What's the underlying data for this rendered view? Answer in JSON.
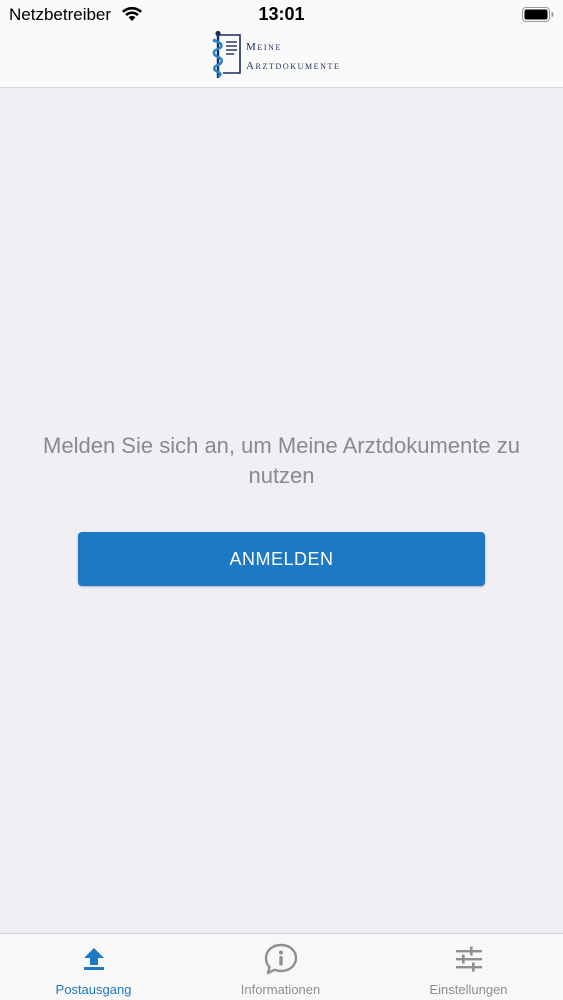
{
  "status_bar": {
    "carrier": "Netzbetreiber",
    "time": "13:01"
  },
  "header": {
    "logo_line1": "Meine",
    "logo_line2": "Arztdokumente",
    "logo_color": "#1a2a5a"
  },
  "main": {
    "message": "Melden Sie sich an, um Meine Arztdokumente zu nutzen",
    "login_button_label": "ANMELDEN",
    "accent_color": "#1d79c3"
  },
  "tab_bar": {
    "tabs": [
      {
        "label": "Postausgang",
        "icon": "upload-icon",
        "active": true
      },
      {
        "label": "Informationen",
        "icon": "info-bubble-icon",
        "active": false
      },
      {
        "label": "Einstellungen",
        "icon": "sliders-icon",
        "active": false
      }
    ]
  }
}
